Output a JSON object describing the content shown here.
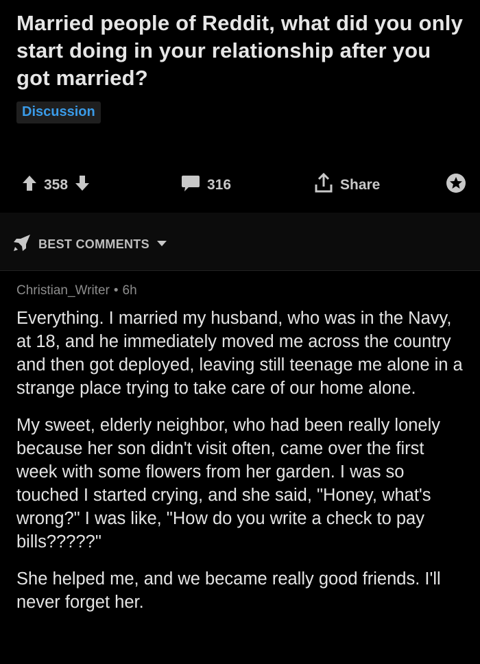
{
  "post": {
    "title": "Married people of Reddit, what did you only start doing in your relationship after you got married?",
    "flair": "Discussion"
  },
  "actions": {
    "upvotes": "358",
    "comments": "316",
    "share_label": "Share"
  },
  "sort": {
    "label": "BEST COMMENTS"
  },
  "comment": {
    "author": "Christian_Writer",
    "age": "6h",
    "paragraphs": [
      "Everything. I married my husband, who was in the Navy, at 18, and he immediately moved me across the country and then got deployed, leaving still teenage me alone in a strange place trying to take care of our home alone.",
      "My sweet, elderly neighbor, who had been really lonely because her son didn't visit often, came over the first week with some flowers from her garden. I was so touched I started crying, and she said, \"Honey, what's wrong?\" I was like, \"How do you write a check to pay bills?????\"",
      "She helped me, and we became really good friends. I'll never forget her."
    ]
  },
  "colors": {
    "background": "#000000",
    "flair_text": "#3a9be8",
    "icon": "#c8c8c8"
  },
  "icons": [
    "upvote-icon",
    "downvote-icon",
    "comment-icon",
    "share-icon",
    "award-icon",
    "rocket-icon",
    "chevron-down-icon"
  ]
}
